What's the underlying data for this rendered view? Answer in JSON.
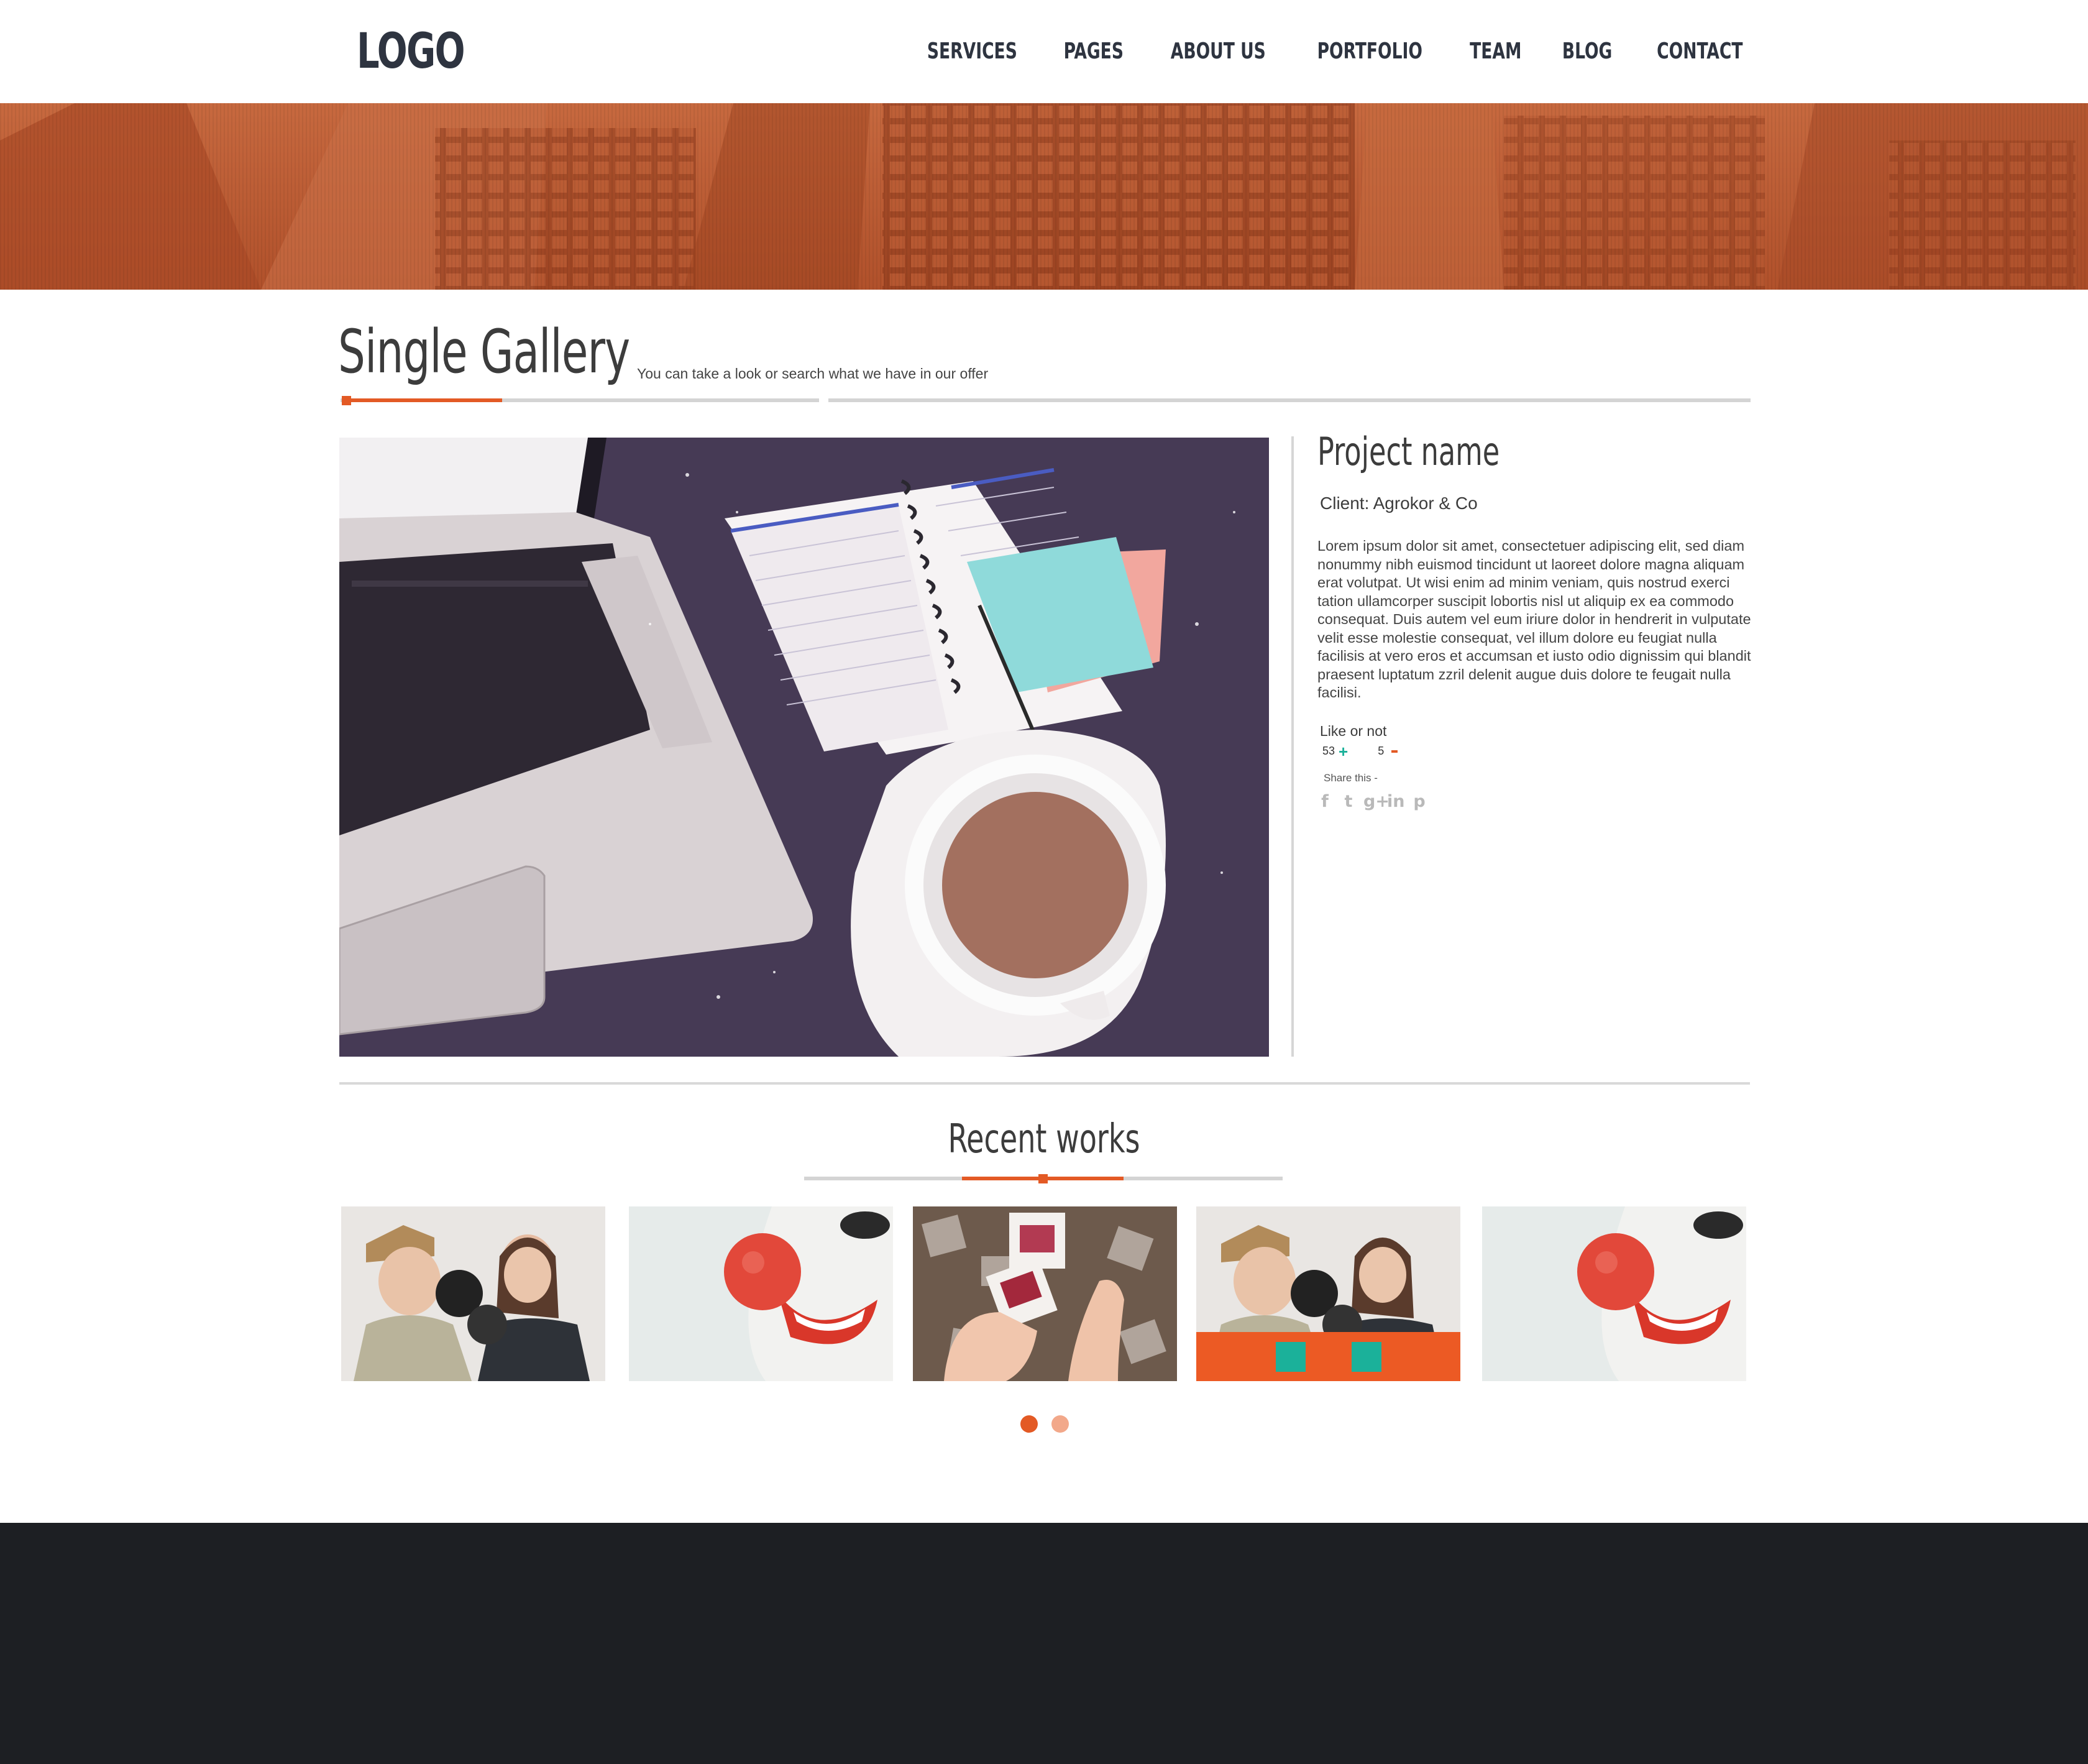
{
  "header": {
    "logo": "LOGO",
    "nav": [
      "SERVICES",
      "PAGES",
      "ABOUT US",
      "PORTFOLIO",
      "TEAM",
      "BLOG",
      "CONTACT"
    ]
  },
  "title": {
    "heading": "Single Gallery",
    "subheading": "You can take a look  or search what we have in our offer"
  },
  "project": {
    "name": "Project name",
    "client": "Client: Agrokor & Co",
    "description": "Lorem ipsum dolor sit amet, consectetuer adipiscing elit, sed diam nonummy nibh euismod tincidunt ut laoreet dolore magna aliquam erat volutpat. Ut wisi enim ad minim veniam, quis nostrud exerci tation ullamcorper suscipit lobortis nisl ut aliquip ex ea commodo consequat. Duis autem vel eum iriure dolor in hendrerit in vulputate velit esse molestie consequat, vel illum dolore eu feugiat nulla facilisis at vero eros et accumsan et iusto odio dignissim qui blandit praesent luptatum zzril delenit augue duis dolore te feugait nulla facilisi.",
    "like_label": "Like or not",
    "likes": "53",
    "dislikes": "5",
    "share_label": "Share this -",
    "social": [
      {
        "icon": "facebook-icon",
        "glyph": "f"
      },
      {
        "icon": "twitter-icon",
        "glyph": "t"
      },
      {
        "icon": "google-plus-icon",
        "glyph": "g+"
      },
      {
        "icon": "linkedin-icon",
        "glyph": "in"
      },
      {
        "icon": "pinterest-icon",
        "glyph": "p"
      }
    ]
  },
  "recent": {
    "heading": "Recent works",
    "thumbnails": [
      "boxing-couple",
      "clown-nose",
      "photo-slides",
      "boxing-couple",
      "clown-nose"
    ],
    "pagination": {
      "pages": 2,
      "active": 1
    }
  },
  "colors": {
    "accent": "#e35a25",
    "teal": "#1bb19a",
    "footer": "#1d1f23",
    "banner": "#b85a33"
  }
}
